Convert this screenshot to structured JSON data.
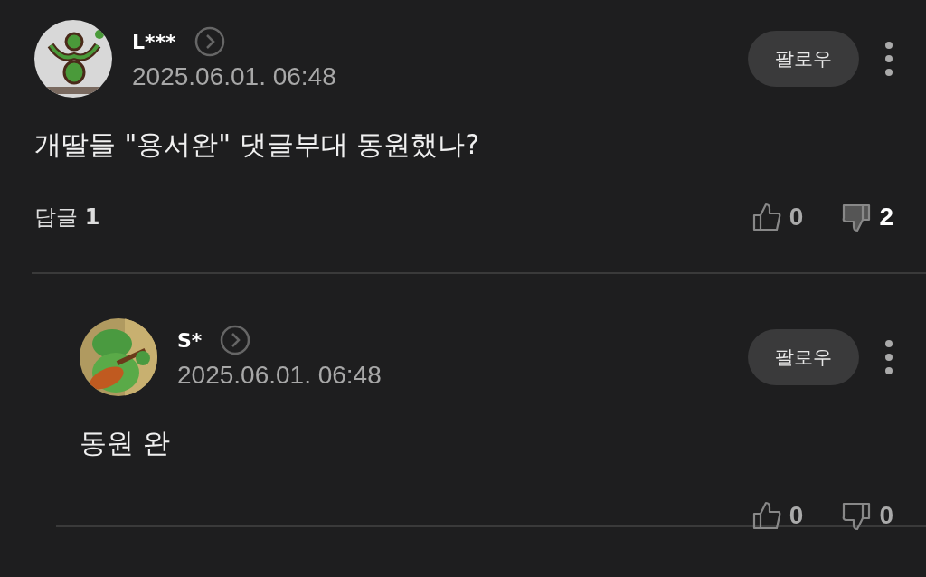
{
  "comments": [
    {
      "author": "L***",
      "date": "2025.06.01. 06:48",
      "follow": "팔로우",
      "text": "개딸들 \"용서완\" 댓글부대 동원했나?",
      "reply_label": "답글",
      "reply_count": "1",
      "likes": "0",
      "dislikes": "2",
      "liked": false,
      "disliked": true,
      "reply": false
    },
    {
      "author": "S*",
      "date": "2025.06.01. 06:48",
      "follow": "팔로우",
      "text": "동원 완",
      "likes": "0",
      "dislikes": "0",
      "liked": false,
      "disliked": false,
      "reply": true
    }
  ]
}
